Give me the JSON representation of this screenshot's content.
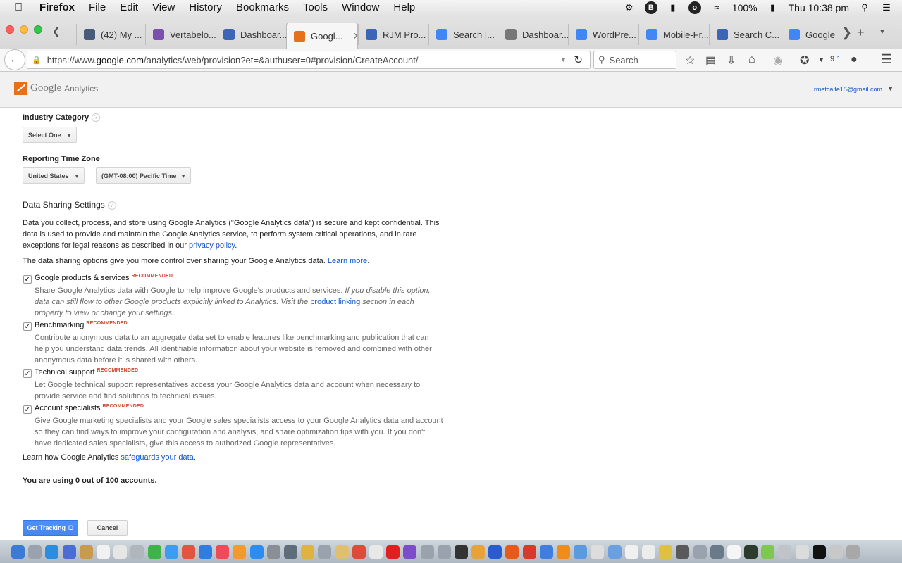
{
  "menubar": {
    "app": "Firefox",
    "items": [
      "File",
      "Edit",
      "View",
      "History",
      "Bookmarks",
      "Tools",
      "Window",
      "Help"
    ],
    "battery": "100%",
    "clock": "Thu 10:38 pm"
  },
  "tabs": [
    {
      "title": "(42) My ...",
      "color": "#4a5a7a"
    },
    {
      "title": "Vertabelo...",
      "color": "#7b4fb0"
    },
    {
      "title": "Dashboar...",
      "color": "#3c66b5"
    },
    {
      "title": "Googl...",
      "color": "#e7711b",
      "active": true
    },
    {
      "title": "RJM Pro...",
      "color": "#3c66b5"
    },
    {
      "title": "Search |...",
      "color": "#4285f4"
    },
    {
      "title": "Dashboar...",
      "color": "#777777"
    },
    {
      "title": "WordPre...",
      "color": "#4285f4"
    },
    {
      "title": "Mobile-Fr...",
      "color": "#4285f4"
    },
    {
      "title": "Search C...",
      "color": "#3c66b5"
    },
    {
      "title": "Google T...",
      "color": "#4285f4"
    }
  ],
  "navbar": {
    "url_prefix": "https://www.",
    "url_host": "google.com",
    "url_path": "/analytics/web/provision?et=&authuser=0#provision/CreateAccount/",
    "search_placeholder": "Search",
    "badge": "9",
    "badge2": "1"
  },
  "ga": {
    "logo_google": "Google",
    "logo_analytics": "Analytics",
    "account": "rmetcalfe15@gmail.com"
  },
  "form": {
    "industry_label": "Industry Category",
    "industry_value": "Select One",
    "timezone_label": "Reporting Time Zone",
    "country_value": "United States",
    "timezone_value": "(GMT-08:00) Pacific Time",
    "sharing_title": "Data Sharing Settings",
    "intro": "Data you collect, process, and store using Google Analytics (\"Google Analytics data\") is secure and kept confidential. This data is used to provide and maintain the Google Analytics service, to perform system critical operations, and in rare exceptions for legal reasons as described in our ",
    "privacy_link": "privacy policy",
    "intro_end": ".",
    "options_note": "The data sharing options give you more control over sharing your Google Analytics data. ",
    "learn_more": "Learn more",
    "learn_more_end": ".",
    "recommended": "RECOMMENDED",
    "options": [
      {
        "title": "Google products & services",
        "checked": true,
        "desc": "Share Google Analytics data with Google to help improve Google's products and services. ",
        "desc_italic": "If you disable this option, data can still flow to other Google products explicitly linked to Analytics. Visit the ",
        "desc_link": "product linking",
        "desc_italic_end": " section in each property to view or change your settings."
      },
      {
        "title": "Benchmarking",
        "checked": true,
        "desc": "Contribute anonymous data to an aggregate data set to enable features like benchmarking and publication that can help you understand data trends. All identifiable information about your website is removed and combined with other anonymous data before it is shared with others."
      },
      {
        "title": "Technical support",
        "checked": true,
        "desc": "Let Google technical support representatives access your Google Analytics data and account when necessary to provide service and find solutions to technical issues."
      },
      {
        "title": "Account specialists",
        "checked": true,
        "desc": "Give Google marketing specialists and your Google sales specialists access to your Google Analytics data and account so they can find ways to improve your configuration and analysis, and share optimization tips with you. If you don't have dedicated sales specialists, give this access to authorized Google representatives."
      }
    ],
    "safeguards_prefix": "Learn how Google Analytics ",
    "safeguards_link": "safeguards your data",
    "safeguards_end": ".",
    "accounts_note": "You are using 0 out of 100 accounts.",
    "submit_label": "Get Tracking ID",
    "cancel_label": "Cancel"
  },
  "dock_colors": [
    "#3b7bd6",
    "#9aa3ad",
    "#2c8ce0",
    "#4a6cd4",
    "#c79a4e",
    "#f1f1f1",
    "#e6e6e6",
    "#b0b6bc",
    "#3db34a",
    "#3b9cf0",
    "#e2543d",
    "#2f7de1",
    "#f04a5a",
    "#f29b2a",
    "#2d8cf0",
    "#8a8f96",
    "#5f6d7a",
    "#e0b340",
    "#9aa3ad",
    "#e0c070",
    "#dd4b39",
    "#e8e8e8",
    "#e02020",
    "#7c4dc8",
    "#9aa3ad",
    "#9aa3ad",
    "#333333",
    "#e8a23a",
    "#2a5ccf",
    "#e85a1a",
    "#d83a2a",
    "#3f7de0",
    "#f08c1a",
    "#5a9ae0",
    "#ddd",
    "#6aa0e0",
    "#f0f0f0",
    "#ececec",
    "#e0c040",
    "#5a5a5a",
    "#9aa3ad",
    "#6b7a88",
    "#f5f5f5",
    "#2d3b2d",
    "#7ec850",
    "#c0c4c8",
    "#dcdcdc",
    "#111111",
    "#c8c8c8",
    "#a8a8a8"
  ]
}
